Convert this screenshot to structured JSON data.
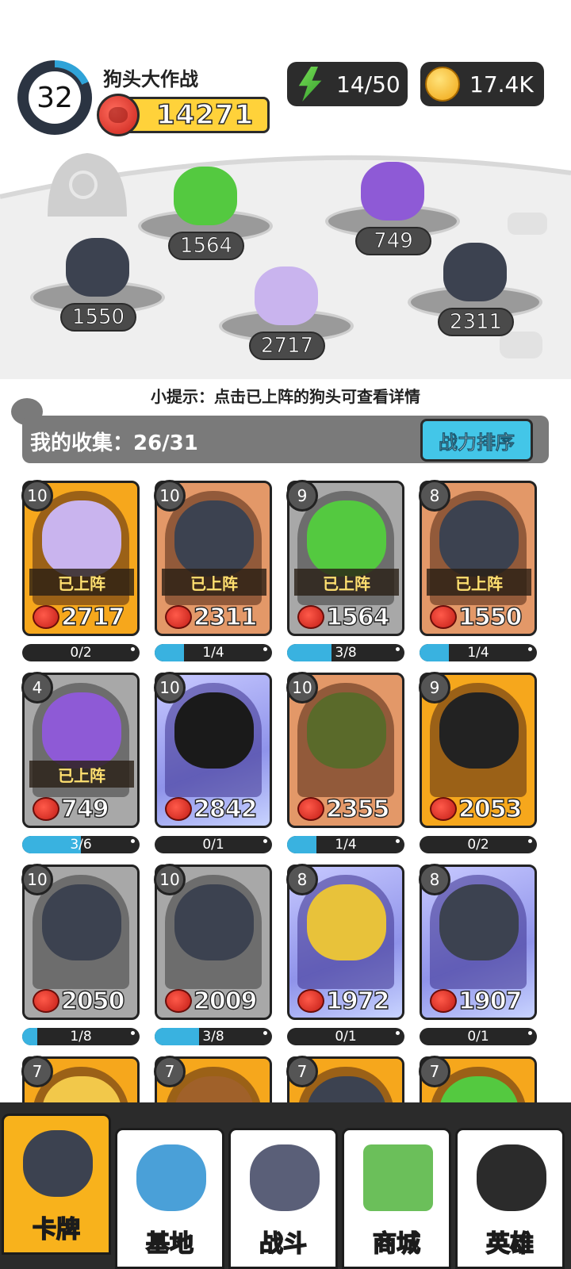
{
  "header": {
    "level": "32",
    "game_title": "狗头大作战",
    "total_power": "14271",
    "energy": "14/50",
    "coins": "17.4K"
  },
  "arena": {
    "slots": [
      {
        "power": "1564",
        "color": "#54c940"
      },
      {
        "power": "749",
        "color": "#8e5ad6"
      },
      {
        "power": "1550",
        "color": "#3c4250"
      },
      {
        "power": "2717",
        "color": "#c9b4ee"
      },
      {
        "power": "2311",
        "color": "#3c4250"
      }
    ],
    "tip": "小提示：点击已上阵的狗头可查看详情"
  },
  "collection": {
    "label": "我的收集：26/31",
    "sort_button": "战力排序"
  },
  "cards": [
    {
      "level": "10",
      "power": "2717",
      "deployed": "已上阵",
      "progress_text": "0/2",
      "progress": 0.0,
      "rarity": "gold",
      "dog_color": "#c9b4ee"
    },
    {
      "level": "10",
      "power": "2311",
      "deployed": "已上阵",
      "progress_text": "1/4",
      "progress": 0.25,
      "rarity": "bronze",
      "dog_color": "#3c4250"
    },
    {
      "level": "9",
      "power": "1564",
      "deployed": "已上阵",
      "progress_text": "3/8",
      "progress": 0.375,
      "rarity": "silver",
      "dog_color": "#54c940"
    },
    {
      "level": "8",
      "power": "1550",
      "deployed": "已上阵",
      "progress_text": "1/4",
      "progress": 0.25,
      "rarity": "bronze",
      "dog_color": "#3c4250"
    },
    {
      "level": "4",
      "power": "749",
      "deployed": "已上阵",
      "progress_text": "3/6",
      "progress": 0.5,
      "rarity": "silver",
      "dog_color": "#8e5ad6"
    },
    {
      "level": "10",
      "power": "2842",
      "deployed": "",
      "progress_text": "0/1",
      "progress": 0.0,
      "rarity": "purple",
      "dog_color": "#1a1a1a"
    },
    {
      "level": "10",
      "power": "2355",
      "deployed": "",
      "progress_text": "1/4",
      "progress": 0.25,
      "rarity": "bronze",
      "dog_color": "#5a6a2a"
    },
    {
      "level": "9",
      "power": "2053",
      "deployed": "",
      "progress_text": "0/2",
      "progress": 0.0,
      "rarity": "gold",
      "dog_color": "#222222"
    },
    {
      "level": "10",
      "power": "2050",
      "deployed": "",
      "progress_text": "1/8",
      "progress": 0.125,
      "rarity": "silver",
      "dog_color": "#3c4250"
    },
    {
      "level": "10",
      "power": "2009",
      "deployed": "",
      "progress_text": "3/8",
      "progress": 0.375,
      "rarity": "silver",
      "dog_color": "#3c4250"
    },
    {
      "level": "8",
      "power": "1972",
      "deployed": "",
      "progress_text": "0/1",
      "progress": 0.0,
      "rarity": "purple",
      "dog_color": "#e8c23a"
    },
    {
      "level": "8",
      "power": "1907",
      "deployed": "",
      "progress_text": "0/1",
      "progress": 0.0,
      "rarity": "purple",
      "dog_color": "#3c4250"
    },
    {
      "level": "7",
      "power": "",
      "deployed": "",
      "progress_text": "",
      "progress": 0.0,
      "rarity": "gold",
      "dog_color": "#f2c84a"
    },
    {
      "level": "7",
      "power": "",
      "deployed": "",
      "progress_text": "",
      "progress": 0.0,
      "rarity": "gold",
      "dog_color": "#a0612a"
    },
    {
      "level": "7",
      "power": "",
      "deployed": "",
      "progress_text": "",
      "progress": 0.0,
      "rarity": "gold",
      "dog_color": "#3c4250"
    },
    {
      "level": "7",
      "power": "",
      "deployed": "",
      "progress_text": "",
      "progress": 0.0,
      "rarity": "gold",
      "dog_color": "#54c940"
    }
  ],
  "nav": {
    "tabs": [
      {
        "label": "卡牌",
        "icon": "dog-card-icon",
        "active": true
      },
      {
        "label": "基地",
        "icon": "castle-icon",
        "active": false
      },
      {
        "label": "战斗",
        "icon": "paw-icon",
        "active": false
      },
      {
        "label": "商城",
        "icon": "money-icon",
        "active": false
      },
      {
        "label": "英雄",
        "icon": "hero-dog-icon",
        "active": false
      }
    ]
  }
}
